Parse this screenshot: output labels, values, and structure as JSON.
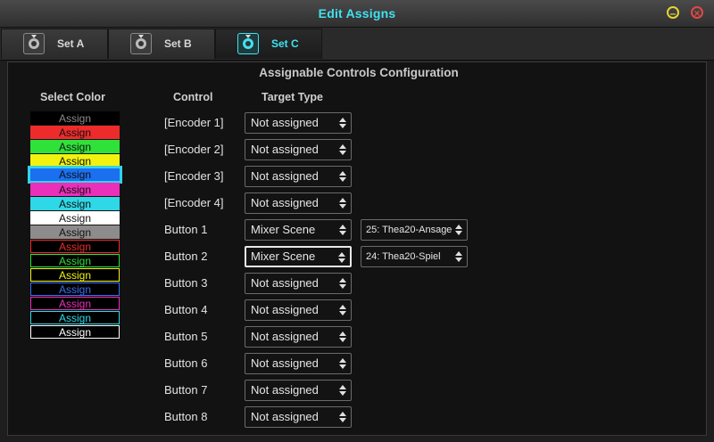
{
  "window": {
    "title": "Edit Assigns"
  },
  "tabs": [
    {
      "label": "Set A",
      "icon": "channel-icon"
    },
    {
      "label": "Set B",
      "icon": "channel-icon"
    },
    {
      "label": "Set C",
      "icon": "channel-icon",
      "active": true
    }
  ],
  "heading": "Assignable Controls Configuration",
  "columns": {
    "select_color": "Select Color",
    "control": "Control",
    "target_type": "Target Type"
  },
  "swatches": [
    {
      "label": "Assign",
      "bg": "#000000",
      "fg": "#8a8a8a",
      "border": "#000000"
    },
    {
      "label": "Assign",
      "bg": "#ee2b2b",
      "fg": "#111111",
      "border": "#ee2b2b"
    },
    {
      "label": "Assign",
      "bg": "#2fe23a",
      "fg": "#111111",
      "border": "#2fe23a"
    },
    {
      "label": "Assign",
      "bg": "#f2f20f",
      "fg": "#111111",
      "border": "#f2f20f"
    },
    {
      "label": "Assign",
      "bg": "#1b6ff0",
      "fg": "#111111",
      "border": "#1b6ff0",
      "selected": true
    },
    {
      "label": "Assign",
      "bg": "#ea2fb8",
      "fg": "#111111",
      "border": "#ea2fb8"
    },
    {
      "label": "Assign",
      "bg": "#2fd8e6",
      "fg": "#111111",
      "border": "#2fd8e6"
    },
    {
      "label": "Assign",
      "bg": "#ffffff",
      "fg": "#111111",
      "border": "#ffffff"
    },
    {
      "label": "Assign",
      "bg": "#8c8c8c",
      "fg": "#111111",
      "border": "#8c8c8c"
    },
    {
      "label": "Assign",
      "bg": "#000000",
      "fg": "#ee2b2b",
      "border": "#ee2b2b"
    },
    {
      "label": "Assign",
      "bg": "#000000",
      "fg": "#2fe23a",
      "border": "#2fe23a"
    },
    {
      "label": "Assign",
      "bg": "#000000",
      "fg": "#f2f20f",
      "border": "#f2f20f"
    },
    {
      "label": "Assign",
      "bg": "#000000",
      "fg": "#3a6ff0",
      "border": "#3a6ff0"
    },
    {
      "label": "Assign",
      "bg": "#000000",
      "fg": "#ea2fb8",
      "border": "#ea2fb8"
    },
    {
      "label": "Assign",
      "bg": "#000000",
      "fg": "#2fd8e6",
      "border": "#2fd8e6"
    },
    {
      "label": "Assign",
      "bg": "#000000",
      "fg": "#ffffff",
      "border": "#ffffff"
    }
  ],
  "controls": [
    {
      "name": "[Encoder 1]",
      "target": "Not assigned"
    },
    {
      "name": "[Encoder 2]",
      "target": "Not assigned"
    },
    {
      "name": "[Encoder 3]",
      "target": "Not assigned"
    },
    {
      "name": "[Encoder 4]",
      "target": "Not assigned"
    },
    {
      "name": "Button 1",
      "target": "Mixer Scene",
      "scene": "25: Thea20-Ansage"
    },
    {
      "name": "Button 2",
      "target": "Mixer Scene",
      "scene": "24: Thea20-Spiel",
      "focused": true
    },
    {
      "name": "Button 3",
      "target": "Not assigned"
    },
    {
      "name": "Button 4",
      "target": "Not assigned"
    },
    {
      "name": "Button 5",
      "target": "Not assigned"
    },
    {
      "name": "Button 6",
      "target": "Not assigned"
    },
    {
      "name": "Button 7",
      "target": "Not assigned"
    },
    {
      "name": "Button 8",
      "target": "Not assigned"
    }
  ],
  "colors": {
    "accent": "#3fe3f0",
    "minimize": "#e8d335",
    "close": "#e04848"
  }
}
